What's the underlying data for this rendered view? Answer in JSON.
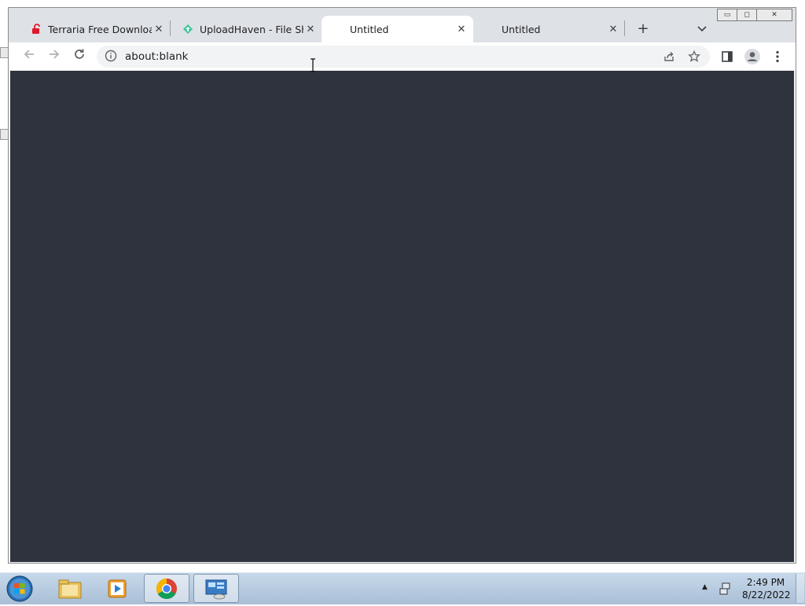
{
  "browser": {
    "tabs": [
      {
        "title": "Terraria Free Download (",
        "active": false,
        "favicon": "lock-open-icon"
      },
      {
        "title": "UploadHaven - File Shar",
        "active": false,
        "favicon": "uploadhaven-icon"
      },
      {
        "title": "Untitled",
        "active": true,
        "favicon": ""
      },
      {
        "title": "Untitled",
        "active": false,
        "favicon": ""
      }
    ],
    "close_glyph": "✕",
    "new_tab_glyph": "+",
    "tab_search_glyph": "⌄",
    "window_controls": {
      "minimize": "▭",
      "maximize": "◻",
      "close": "✕"
    },
    "address": "about:blank",
    "colors": {
      "content_bg": "#2f333d",
      "tabstrip_bg": "#dee1e6",
      "toolbar_bg": "#ffffff"
    }
  },
  "taskbar": {
    "apps": [
      {
        "name": "file-explorer",
        "active": false
      },
      {
        "name": "media-player",
        "active": false
      },
      {
        "name": "chrome",
        "active": true
      },
      {
        "name": "control-panel",
        "active": true
      }
    ],
    "clock": {
      "time": "2:49 PM",
      "date": "8/22/2022"
    },
    "tray_arrow": "▲"
  }
}
